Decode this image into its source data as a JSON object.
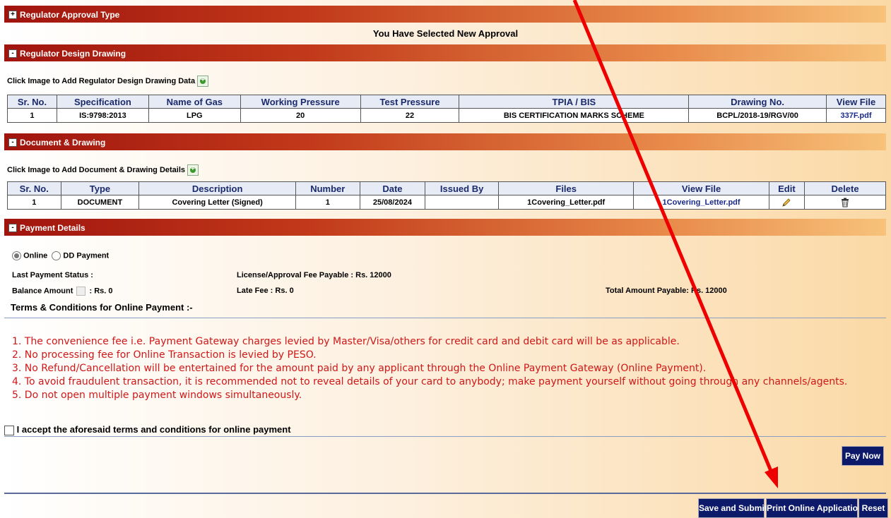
{
  "sections": {
    "approval_type": {
      "title": "Regulator Approval Type",
      "toggle": "+",
      "selected_msg": "You Have Selected New Approval"
    },
    "design": {
      "title": "Regulator Design Drawing",
      "toggle": "-",
      "add_label": "Click Image to Add Regulator Design Drawing Data"
    },
    "document": {
      "title": "Document & Drawing",
      "toggle": "-",
      "add_label": "Click Image to Add Document & Drawing Details"
    },
    "payment": {
      "title": "Payment Details",
      "toggle": "-"
    }
  },
  "design_table": {
    "headers": [
      "Sr. No.",
      "Specification",
      "Name of Gas",
      "Working Pressure",
      "Test Pressure",
      "TPIA / BIS",
      "Drawing No.",
      "View File"
    ],
    "row": [
      "1",
      "IS:9798:2013",
      "LPG",
      "20",
      "22",
      "BIS CERTIFICATION MARKS SCHEME",
      "BCPL/2018-19/RGV/00",
      "337F.pdf"
    ]
  },
  "doc_table": {
    "headers": [
      "Sr. No.",
      "Type",
      "Description",
      "Number",
      "Date",
      "Issued By",
      "Files",
      "View File",
      "Edit",
      "Delete"
    ],
    "row": [
      "1",
      "DOCUMENT",
      "Covering Letter (Signed)",
      "1",
      "25/08/2024",
      "",
      "1Covering_Letter.pdf",
      "1Covering_Letter.pdf"
    ]
  },
  "payment": {
    "online_label": "Online",
    "dd_label": "DD Payment",
    "last_status": "Last Payment Status :",
    "fee_payable": "License/Approval Fee Payable : Rs. 12000",
    "balance_label": "Balance Amount",
    "balance_value": ": Rs. 0",
    "late_fee": "Late Fee : Rs. 0",
    "total_payable": "Total Amount Payable: Rs. 12000",
    "terms_title": "Terms & Conditions for Online Payment :-",
    "terms": [
      "1. The convenience fee i.e. Payment Gateway charges levied by Master/Visa/others for credit card and debit card will be as applicable.",
      "2. No processing fee for Online Transaction is levied by PESO.",
      "3. No Refund/Cancellation will be entertained for the amount paid by any applicant through the Online Payment Gateway (Online Payment).",
      "4. To avoid fraudulent transaction, it is recommended not to reveal details of your card to anybody; make payment yourself without going through any channels/agents.",
      "5. Do not open multiple payment windows simultaneously."
    ],
    "accept_label": "I accept the aforesaid terms and conditions for online payment",
    "pay_now": "Pay Now"
  },
  "footer": {
    "save_submit": "Save and Submit",
    "print": "Print Online Application",
    "reset": "Reset"
  },
  "colors": {
    "header_dark": "#a0140e",
    "header_light": "#f7c27a",
    "button": "#0d1a6a",
    "terms_text": "#d01818",
    "arrow": "#ee0000"
  },
  "icons": [
    "plus-toggle-icon",
    "minus-toggle-icon",
    "add-data-icon",
    "edit-pencil-icon",
    "trash-icon",
    "radio-icon",
    "checkbox-icon",
    "red-arrow-annotation"
  ]
}
